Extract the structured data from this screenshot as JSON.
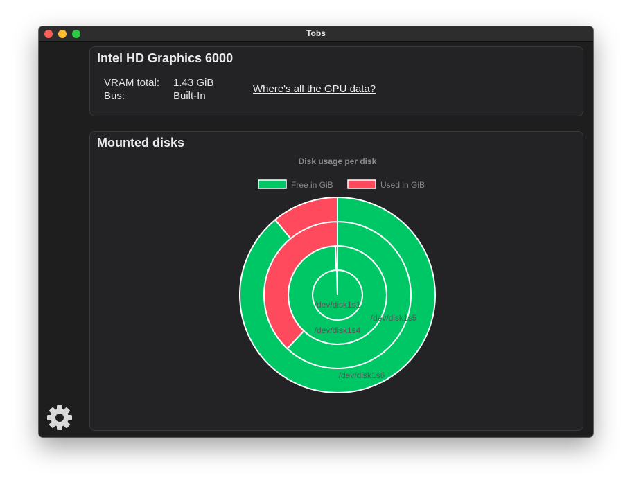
{
  "window": {
    "title": "Tobs"
  },
  "gpu": {
    "name": "Intel HD Graphics 6000",
    "vram_label": "VRAM total:",
    "vram_value": "1.43 GiB",
    "bus_label": "Bus:",
    "bus_value": "Built-In",
    "link_text": "Where's all the GPU data?"
  },
  "disks": {
    "title": "Mounted disks"
  },
  "sidebar": {
    "settings_icon": "gear-icon"
  },
  "colors": {
    "free": "#00c766",
    "used": "#ff4a5d",
    "chart_text": "#8a8a8a"
  },
  "chart_data": {
    "type": "doughnut",
    "title": "Disk usage per disk",
    "legend": {
      "position": "top",
      "entries": [
        "Free in GiB",
        "Used in GiB"
      ]
    },
    "series": [
      {
        "name": "/dev/disk1s1",
        "values": [
          99.6,
          0.4
        ]
      },
      {
        "name": "/dev/disk1s4",
        "values": [
          99.3,
          0.7
        ]
      },
      {
        "name": "/dev/disk1s5",
        "values": [
          62,
          38
        ]
      },
      {
        "name": "/dev/disk1s6",
        "values": [
          89,
          11
        ]
      }
    ]
  }
}
